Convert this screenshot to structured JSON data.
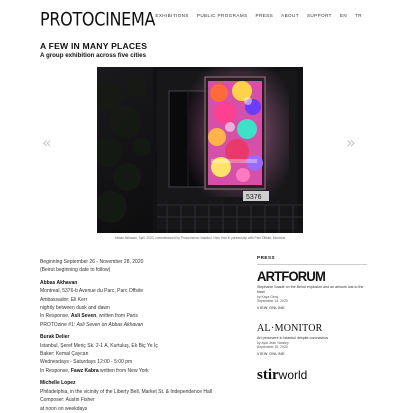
{
  "header": {
    "logo": "PROTOCINEMA",
    "nav": [
      "EXHIBITIONS",
      "PUBLIC PROGRAMS",
      "PRESS",
      "ABOUT",
      "SUPPORT",
      "EN",
      "TR"
    ]
  },
  "exhibition": {
    "title": "A FEW IN MANY PLACES",
    "subtitle": "A group exhibition across five cities"
  },
  "gallery": {
    "prev_icon": "double-chevron-left-icon",
    "next_icon": "double-chevron-right-icon",
    "prev_glyph": "«",
    "next_glyph": "»",
    "caption": "Abbas Akhavan, Spill, 2020, commissioned by Protocinema; Istanbul, New York in partnership with Parc Offsite, Montreal"
  },
  "main": {
    "dates": "Beginning September 26 - November 28, 2020",
    "dates_note": "(Beirut beginning date to follow)",
    "artists": [
      {
        "name": "Abbas Akhavan",
        "lines": [
          "Montreal, 5376-b Avenue du Parc, Parc Offsite",
          "Ambassador: Eli Kerr",
          "nightly between dusk and dawn"
        ],
        "response_prefix": "In Response, ",
        "response_author": "Asli Seven",
        "response_suffix": ", written from Paris",
        "proto_prefix": "PROTOzine #1: ",
        "proto_title": "Asli Seven on Abbas Akhavan"
      },
      {
        "name": "Burak Delier",
        "lines": [
          "Istanbul, Şeref Meriç Sk. 2-1 A, Kurtuluş, Ek Biç Ye İç",
          "Baker: Kemal Çaycan",
          "Wednesdays - Saturdays 12:00 - 5:00 pm"
        ],
        "response_prefix": "In Response, ",
        "response_author": "Fawz Kabra",
        "response_suffix": " written from New York"
      },
      {
        "name": "Michelle Lopez",
        "lines": [
          "Philadelphia, in the vicinity of the Liberty Bell, Market St. & Independence Hall",
          "Composer: Austin Fisher",
          "at noon on weekdays"
        ]
      }
    ]
  },
  "press": {
    "heading": "PRESS",
    "view_label": "VIEW ONLINE",
    "items": [
      {
        "brand": "ARTFORUM",
        "blurb": "Stephanie Saadé on the Beirut explosion and an artwork lost to the blast",
        "author": "by Kaya Genç",
        "date": "September 14, 2020"
      },
      {
        "brand_main": "AL",
        "brand_dot": "·",
        "brand_rest": "MONITOR",
        "blurb": "Art persevere in Istanbul despite coronavirus",
        "author": "by Ayla Jean Yackley",
        "date": "September 19, 2020"
      },
      {
        "brand_main": "stir",
        "brand_rest": "world"
      }
    ]
  }
}
